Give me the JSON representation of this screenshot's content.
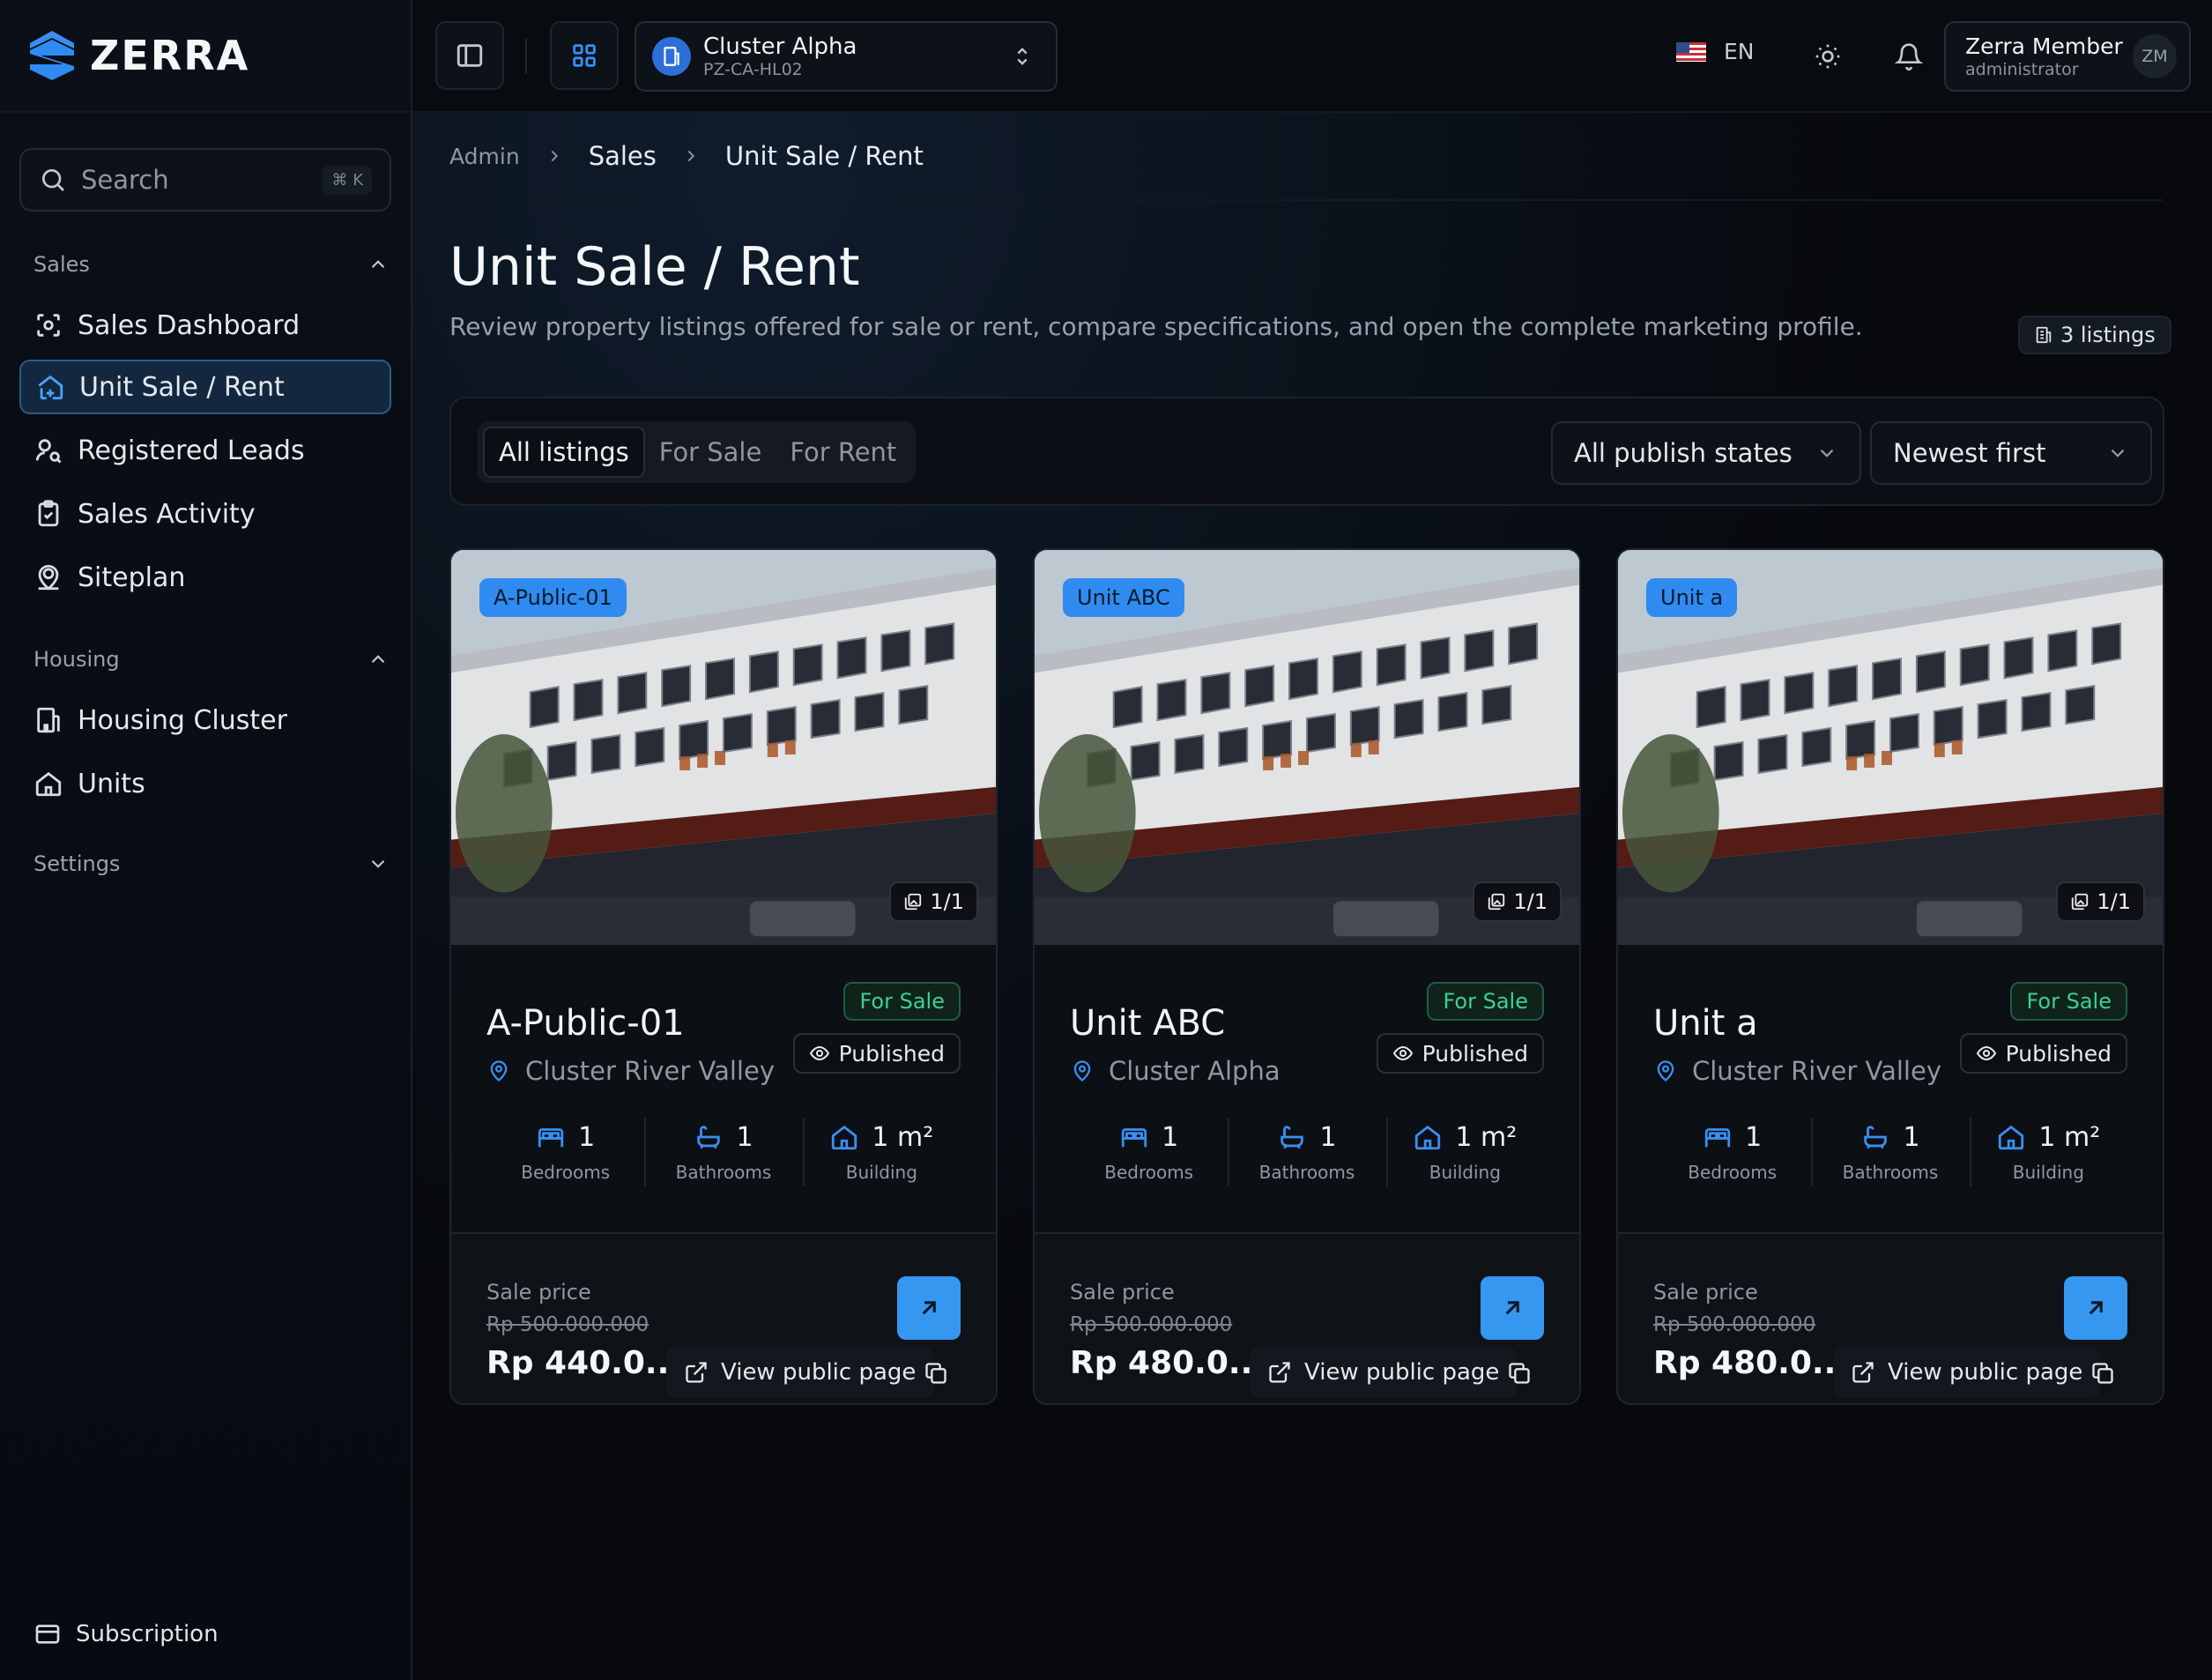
{
  "app": {
    "brand": "ZERRA",
    "accent_color": "#2f8bf0",
    "success_color": "#3fcf95"
  },
  "sidebar": {
    "search": {
      "label": "Search",
      "shortcut": "⌘ K"
    },
    "sections": [
      {
        "label": "Sales",
        "expanded": true,
        "items": [
          {
            "label": "Sales Dashboard",
            "icon": "scan-dashboard-icon"
          },
          {
            "label": "Unit Sale / Rent",
            "icon": "house-plus-icon",
            "active": true
          },
          {
            "label": "Registered Leads",
            "icon": "user-search-icon"
          },
          {
            "label": "Sales Activity",
            "icon": "clipboard-check-icon"
          },
          {
            "label": "Siteplan",
            "icon": "map-pin-user-icon"
          }
        ]
      },
      {
        "label": "Housing",
        "expanded": true,
        "items": [
          {
            "label": "Housing Cluster",
            "icon": "building-icon"
          },
          {
            "label": "Units",
            "icon": "home-icon"
          }
        ]
      },
      {
        "label": "Settings",
        "expanded": false,
        "items": []
      }
    ],
    "footer": {
      "label": "Subscription",
      "icon": "credit-card-icon"
    }
  },
  "topbar": {
    "cluster": {
      "name": "Cluster Alpha",
      "code": "PZ-CA-HL02"
    },
    "language": "EN",
    "user": {
      "name": "Zerra Member",
      "role": "administrator",
      "initials": "ZM"
    }
  },
  "breadcrumb": [
    "Admin",
    "Sales",
    "Unit Sale / Rent"
  ],
  "page": {
    "title": "Unit Sale / Rent",
    "subtitle": "Review property listings offered for sale or rent, compare specifications, and open the complete marketing profile.",
    "count_label": "3 listings"
  },
  "filters": {
    "tabs": [
      "All listings",
      "For Sale",
      "For Rent"
    ],
    "active_tab": "All listings",
    "publish_state": "All publish states",
    "sort": "Newest first"
  },
  "listings": [
    {
      "tag": "A-Public-01",
      "name": "A-Public-01",
      "photo_count": "1/1",
      "status": "For Sale",
      "publish": "Published",
      "location": "Cluster River Valley",
      "bedrooms": "1",
      "bathrooms": "1",
      "building": "1 m²",
      "bedrooms_label": "Bedrooms",
      "bathrooms_label": "Bathrooms",
      "building_label": "Building",
      "price_label": "Sale price",
      "price_old": "Rp 500.000.000",
      "price_new": "Rp 440.0...",
      "view_label": "View public page"
    },
    {
      "tag": "Unit ABC",
      "name": "Unit ABC",
      "photo_count": "1/1",
      "status": "For Sale",
      "publish": "Published",
      "location": "Cluster Alpha",
      "bedrooms": "1",
      "bathrooms": "1",
      "building": "1 m²",
      "bedrooms_label": "Bedrooms",
      "bathrooms_label": "Bathrooms",
      "building_label": "Building",
      "price_label": "Sale price",
      "price_old": "Rp 500.000.000",
      "price_new": "Rp 480.0...",
      "view_label": "View public page"
    },
    {
      "tag": "Unit a",
      "name": "Unit a",
      "photo_count": "1/1",
      "status": "For Sale",
      "publish": "Published",
      "location": "Cluster River Valley",
      "bedrooms": "1",
      "bathrooms": "1",
      "building": "1 m²",
      "bedrooms_label": "Bedrooms",
      "bathrooms_label": "Bathrooms",
      "building_label": "Building",
      "price_label": "Sale price",
      "price_old": "Rp 500.000.000",
      "price_new": "Rp 480.0...",
      "view_label": "View public page"
    }
  ]
}
